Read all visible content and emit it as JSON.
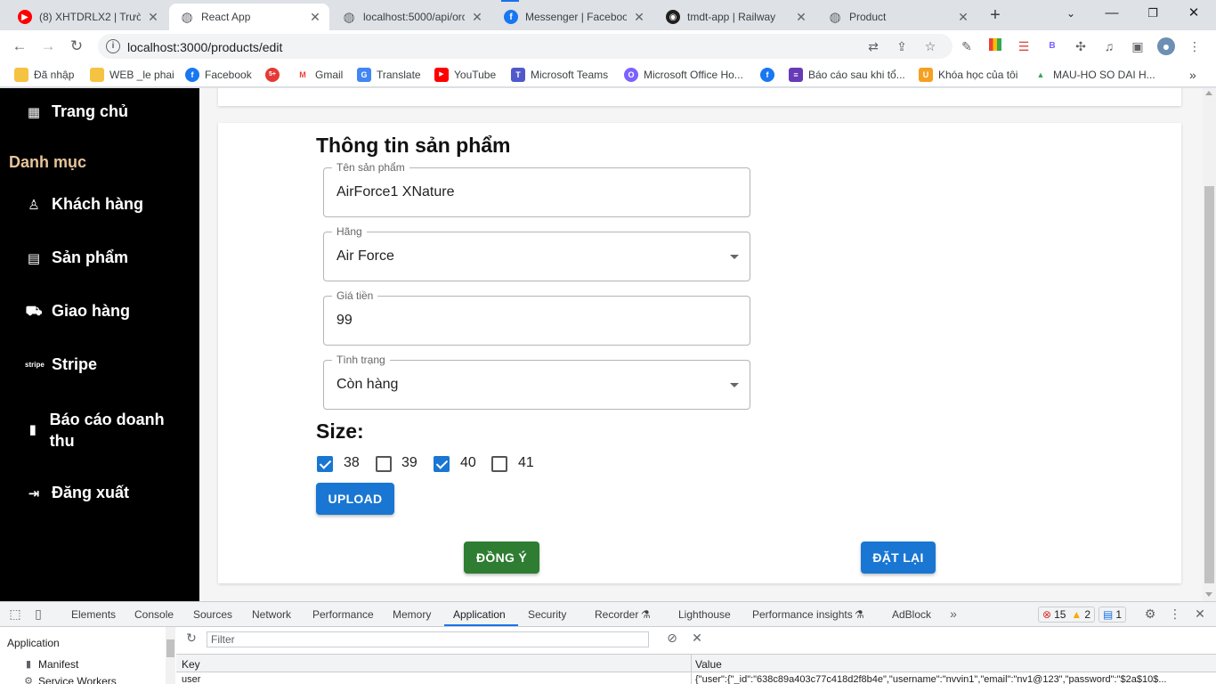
{
  "browser": {
    "tabs": [
      {
        "title": "(8) XHTDRLX2 | Trường",
        "favicon": "youtube-icon",
        "color": "#ff0000",
        "glyph": "▶"
      },
      {
        "title": "React App",
        "favicon": "globe-icon",
        "color": "#5f6368",
        "glyph": "◍"
      },
      {
        "title": "localhost:5000/api/orc",
        "favicon": "globe-icon",
        "color": "#5f6368",
        "glyph": "◍"
      },
      {
        "title": "Messenger | Facebook",
        "favicon": "facebook-icon",
        "color": "#1877f2",
        "glyph": "f"
      },
      {
        "title": "tmdt-app | Railway",
        "favicon": "railway-icon",
        "color": "#1f1f1f",
        "glyph": "◉"
      },
      {
        "title": "Product",
        "favicon": "globe-icon",
        "color": "#5f6368",
        "glyph": "◍"
      }
    ],
    "active_tab": 1,
    "url": "localhost:3000/products/edit"
  },
  "bookmarks": [
    {
      "label": "Đã nhập",
      "icon": "folder-icon",
      "color": "#f5c342",
      "glyph": ""
    },
    {
      "label": "WEB _le phai",
      "icon": "folder-icon",
      "color": "#f5c342",
      "glyph": ""
    },
    {
      "label": "Facebook",
      "icon": "facebook-icon",
      "color": "#1877f2",
      "glyph": "f"
    },
    {
      "label": "",
      "icon": "badge-icon",
      "color": "#e53935",
      "glyph": "5+"
    },
    {
      "label": "Gmail",
      "icon": "gmail-icon",
      "color": "#ea4335",
      "glyph": "M"
    },
    {
      "label": "Translate",
      "icon": "translate-icon",
      "color": "#4285f4",
      "glyph": "G"
    },
    {
      "label": "YouTube",
      "icon": "youtube-icon",
      "color": "#ff0000",
      "glyph": "▶"
    },
    {
      "label": "Microsoft Teams",
      "icon": "teams-icon",
      "color": "#5059c9",
      "glyph": "T"
    },
    {
      "label": "Microsoft Office Ho...",
      "icon": "office-icon",
      "color": "#7b61ff",
      "glyph": "O"
    },
    {
      "label": "",
      "icon": "facebook-icon",
      "color": "#1877f2",
      "glyph": "f"
    },
    {
      "label": "Báo cáo sau khi tổ...",
      "icon": "forms-icon",
      "color": "#673ab7",
      "glyph": "≡"
    },
    {
      "label": "Khóa học của tôi",
      "icon": "udemy-icon",
      "color": "#f4a020",
      "glyph": "U"
    },
    {
      "label": "MAU-HO SO DAI H...",
      "icon": "drive-icon",
      "color": "#34a853",
      "glyph": "▲"
    }
  ],
  "sidebar": {
    "home": "Trang chủ",
    "heading": "Danh mục",
    "items": [
      {
        "label": "Khách hàng",
        "icon": "user-icon",
        "glyph": "♙"
      },
      {
        "label": "Sản phẩm",
        "icon": "store-icon",
        "glyph": "▤"
      },
      {
        "label": "Giao hàng",
        "icon": "truck-icon",
        "glyph": "⛟"
      },
      {
        "label": "Stripe",
        "icon": "stripe-icon",
        "glyph": "stripe"
      },
      {
        "label": "Báo cáo doanh thu",
        "icon": "bar-chart-icon",
        "glyph": "▮"
      },
      {
        "label": "Đăng xuất",
        "icon": "logout-icon",
        "glyph": "⇥"
      }
    ]
  },
  "form": {
    "title": "Thông tin sản phẩm",
    "name": {
      "label": "Tên sản phẩm",
      "value": "AirForce1 XNature"
    },
    "brand": {
      "label": "Hãng",
      "value": "Air Force"
    },
    "price": {
      "label": "Giá tiền",
      "value": "99"
    },
    "status": {
      "label": "Tình trạng",
      "value": "Còn hàng"
    },
    "size_label": "Size:",
    "sizes": [
      {
        "label": "38",
        "checked": true
      },
      {
        "label": "39",
        "checked": false
      },
      {
        "label": "40",
        "checked": true
      },
      {
        "label": "41",
        "checked": false
      }
    ],
    "upload": "UPLOAD",
    "submit": "ĐỒNG Ý",
    "reset": "ĐẶT LẠI",
    "colors": {
      "primary": "#1976d2",
      "success": "#2e7d32"
    }
  },
  "devtools": {
    "tabs": [
      "Elements",
      "Console",
      "Sources",
      "Network",
      "Performance",
      "Memory",
      "Application",
      "Security",
      "Recorder",
      "Lighthouse",
      "Performance insights",
      "AdBlock"
    ],
    "active_tab": "Application",
    "errors": "15",
    "warnings": "2",
    "messages": "1",
    "sidebar_title": "Application",
    "sidebar_items": [
      "Manifest",
      "Service Workers"
    ],
    "filter_placeholder": "Filter",
    "columns": [
      "Key",
      "Value"
    ],
    "row": {
      "key": "user",
      "value": "{\"user\":{\"_id\":\"638c89a403c77c418d2f8b4e\",\"username\":\"nvvin1\",\"email\":\"nv1@123\",\"password\":\"$2a$10$..."
    }
  }
}
